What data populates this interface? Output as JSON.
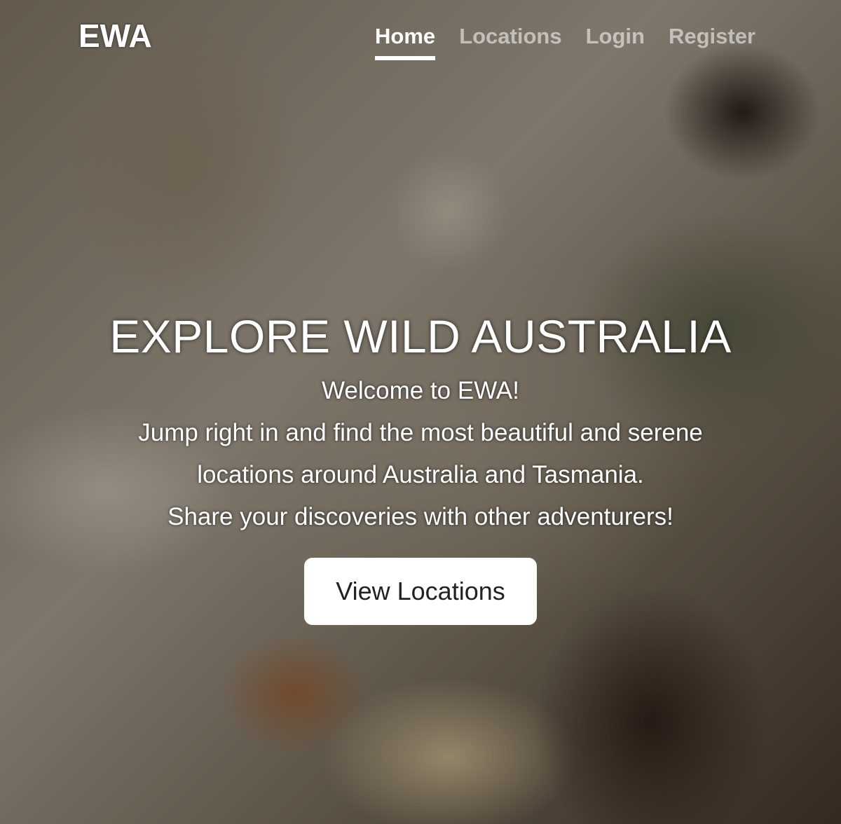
{
  "navbar": {
    "brand": "EWA",
    "links": [
      {
        "label": "Home",
        "active": true
      },
      {
        "label": "Locations",
        "active": false
      },
      {
        "label": "Login",
        "active": false
      },
      {
        "label": "Register",
        "active": false
      }
    ]
  },
  "hero": {
    "title": "EXPLORE WILD AUSTRALIA",
    "lines": [
      "Welcome to EWA!",
      "Jump right in and find the most beautiful and serene",
      "locations around Australia and Tasmania.",
      "Share your discoveries with other adventurers!"
    ],
    "cta_label": "View Locations"
  },
  "colors": {
    "text": "#ffffff",
    "nav_inactive": "rgba(255,255,255,0.55)",
    "button_bg": "#ffffff",
    "button_text": "#222222"
  }
}
